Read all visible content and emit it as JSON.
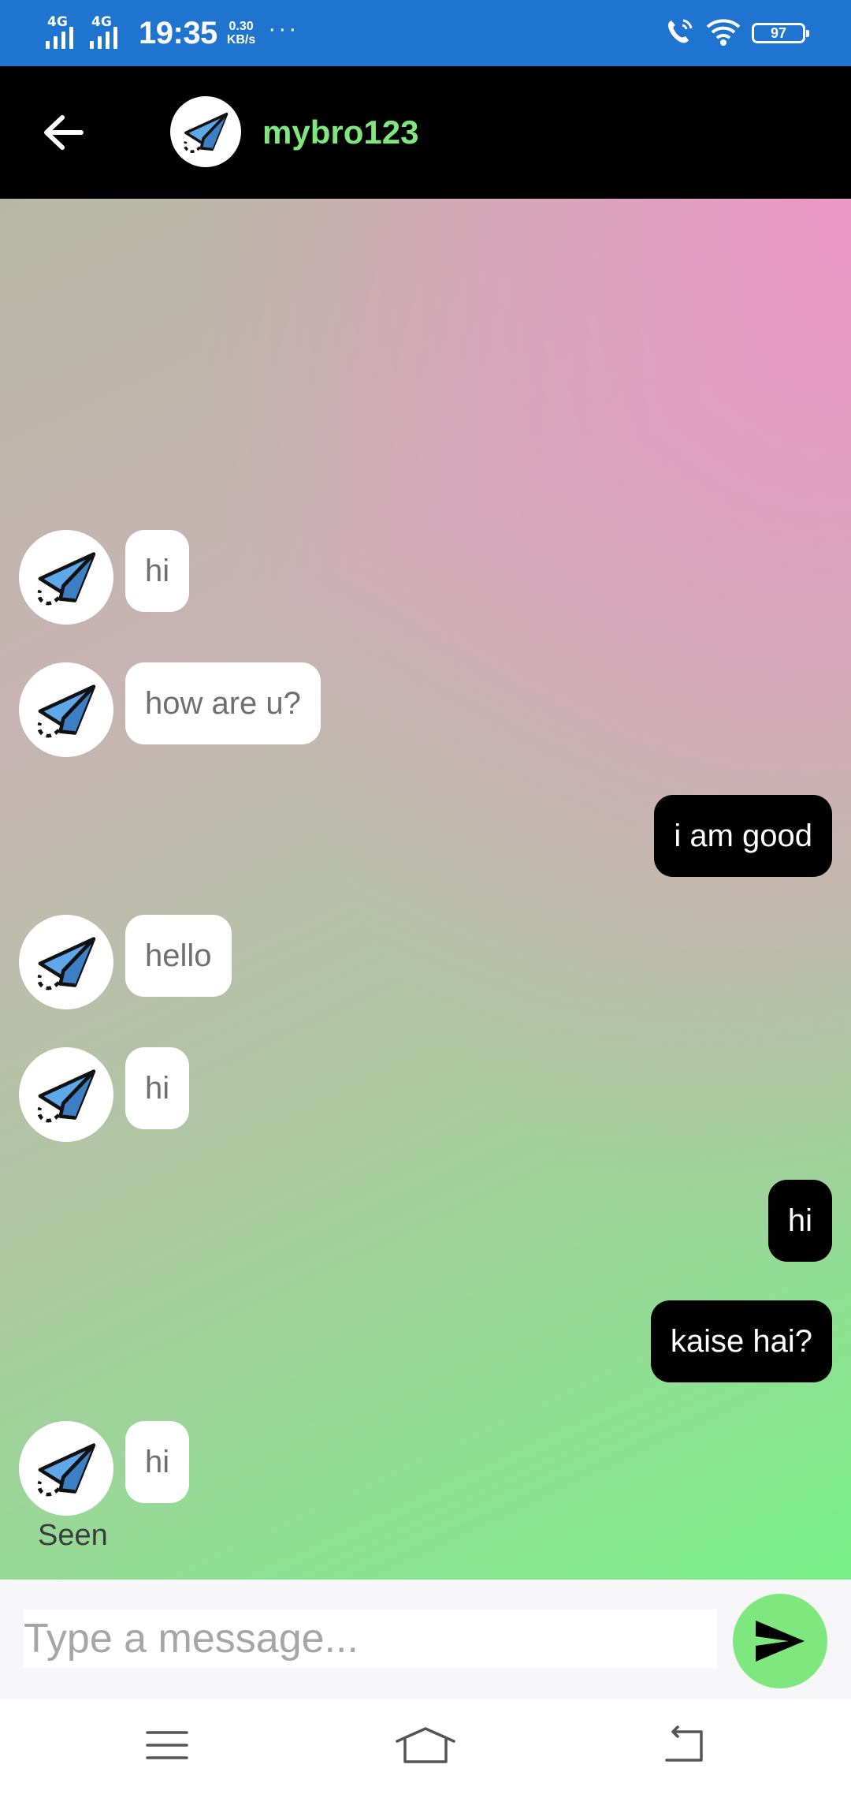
{
  "status_bar": {
    "signal1_label": "4G",
    "signal2_label": "4G",
    "time": "19:35",
    "speed_value": "0.30",
    "speed_unit": "KB/s",
    "overflow": "···",
    "battery": "97"
  },
  "header": {
    "contact_name": "mybro123",
    "contact_name_color": "#7ee87e"
  },
  "messages": [
    {
      "direction": "in",
      "text": "hi"
    },
    {
      "direction": "in",
      "text": "how are u?"
    },
    {
      "direction": "out",
      "text": "i am good"
    },
    {
      "direction": "in",
      "text": "hello"
    },
    {
      "direction": "in",
      "text": "hi"
    },
    {
      "direction": "out",
      "text": "hi"
    },
    {
      "direction": "out",
      "text": "kaise hai?"
    },
    {
      "direction": "in",
      "text": "hi"
    }
  ],
  "seen_label": "Seen",
  "composer": {
    "placeholder": "Type a message...",
    "value": ""
  },
  "colors": {
    "status_bar": "#1f74cf",
    "app_bar": "#000000",
    "accent_green": "#7ee87e",
    "outgoing_bubble": "#000000",
    "incoming_bubble": "#ffffff"
  },
  "icons": {
    "back": "arrow-left-icon",
    "avatar": "paper-plane-icon",
    "send": "send-icon",
    "nav_menu": "menu-icon",
    "nav_home": "home-icon",
    "nav_back": "nav-back-icon"
  }
}
